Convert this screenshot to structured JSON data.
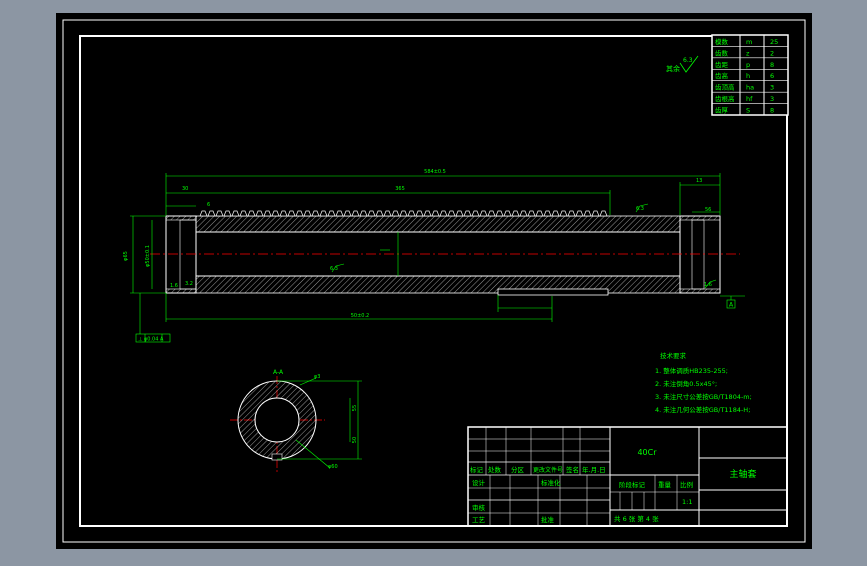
{
  "colors": {
    "background": "#8c96a3",
    "canvas": "#000000",
    "frame": "#ffffff",
    "geometry": "#ffffff",
    "dimension": "#00ff00",
    "centerline": "#ff0000",
    "text_green": "#00ff00",
    "text_yellow": "#ffff00"
  },
  "gear_params": {
    "rows": [
      {
        "label": "模数",
        "sym": "m",
        "val": "25"
      },
      {
        "label": "齿数",
        "sym": "z",
        "val": "2"
      },
      {
        "label": "齿距",
        "sym": "p",
        "val": "8"
      },
      {
        "label": "齿高",
        "sym": "h",
        "val": "6"
      },
      {
        "label": "齿顶高",
        "sym": "ha",
        "val": "3"
      },
      {
        "label": "齿根高",
        "sym": "hf",
        "val": "3"
      },
      {
        "label": "齿厚",
        "sym": "S",
        "val": "8"
      }
    ]
  },
  "roughness_note": {
    "label": "其余",
    "value": "6.3"
  },
  "dimensions": {
    "overall_length": "584±0.5",
    "left_step": "30",
    "thread_length": "365",
    "right_end": "13",
    "left_small": "6",
    "right_small": "56",
    "diameter_outer": "φ65",
    "diameter_mid": "φ50±0.1",
    "bottom_length": "50±0.2",
    "roughness_a": "1.6",
    "roughness_b": "3.2",
    "roughness_c": "6.3",
    "roughness_d": "6.3",
    "roughness_e": "1.6",
    "datum": "A",
    "tolerance_frame": "⊥  φ0.04  A"
  },
  "section_view": {
    "label": "A-A",
    "dim_r": "φ3",
    "dim_h1": "55",
    "dim_h2": "50",
    "dim_d": "φ60"
  },
  "tech_req": {
    "title": "技术要求",
    "items": [
      "1. 整体调质HB235-255;",
      "2. 未注倒角0.5x45°;",
      "3. 未注尺寸公差按GB/T1804-m;",
      "4. 未注几何公差按GB/T1184-H;"
    ]
  },
  "title_block": {
    "material": "40Cr",
    "part_name": "主轴套",
    "scale_label": "比例",
    "scale": "1:1",
    "sheet_info": "共  6  张     第  4  张",
    "mark_label": "阶段标记",
    "weight_label": "重量",
    "header_labels": [
      "标记",
      "处数",
      "分区",
      "更改文件号",
      "签名",
      "年.月.日"
    ],
    "design": "设计",
    "standardize": "标准化",
    "review": "审核",
    "process": "工艺",
    "approve": "批准"
  }
}
